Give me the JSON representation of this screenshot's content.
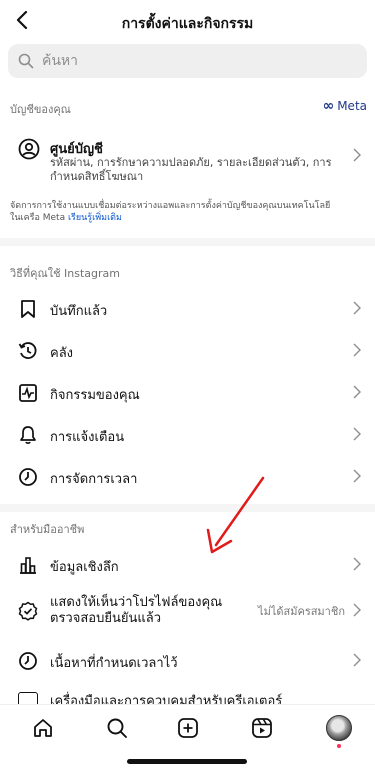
{
  "header": {
    "title": "การตั้งค่าและกิจกรรม"
  },
  "search": {
    "placeholder": "ค้นหา"
  },
  "account_section": {
    "label": "บัญชีของคุณ",
    "meta_label": "Meta",
    "center": {
      "title": "ศูนย์บัญชี",
      "subtitle": "รหัสผ่าน, การรักษาความปลอดภัย, รายละเอียดส่วนตัว, การกำหนดสิทธิ์โฆษณา"
    },
    "note": "จัดการการใช้งานแบบเชื่อมต่อระหว่างแอพและการตั้งค่าบัญชีของคุณบนเทคโนโลยีในเครือ Meta",
    "note_link": "เรียนรู้เพิ่มเติม"
  },
  "usage_section": {
    "label": "วิธีที่คุณใช้ Instagram",
    "items": [
      {
        "label": "บันทึกแล้ว",
        "icon": "bookmark-icon"
      },
      {
        "label": "คลัง",
        "icon": "archive-icon"
      },
      {
        "label": "กิจกรรมของคุณ",
        "icon": "activity-icon"
      },
      {
        "label": "การแจ้งเตือน",
        "icon": "bell-icon"
      },
      {
        "label": "การจัดการเวลา",
        "icon": "clock-icon"
      }
    ]
  },
  "pro_section": {
    "label": "สำหรับมืออาชีพ",
    "items": [
      {
        "label": "ข้อมูลเชิงลึก",
        "icon": "bar-chart-icon"
      },
      {
        "label": "แสดงให้เห็นว่าโปรไฟล์ของคุณตรวจสอบยืนยันแล้ว",
        "icon": "verified-badge-icon",
        "right_text": "ไม่ได้สมัครสมาชิก"
      },
      {
        "label": "เนื้อหาที่กำหนดเวลาไว้",
        "icon": "scheduled-icon"
      },
      {
        "label": "เครื่องมือและการควบคุมสำหรับครีเอเตอร์",
        "icon": "tools-icon"
      }
    ]
  },
  "bottom_nav": [
    "home-icon",
    "search-icon",
    "create-icon",
    "reels-icon",
    "profile-avatar"
  ],
  "colors": {
    "accent_link": "#0b57d0",
    "meta_blue": "#1e3a8a",
    "annotation_arrow": "#e01b1b"
  }
}
